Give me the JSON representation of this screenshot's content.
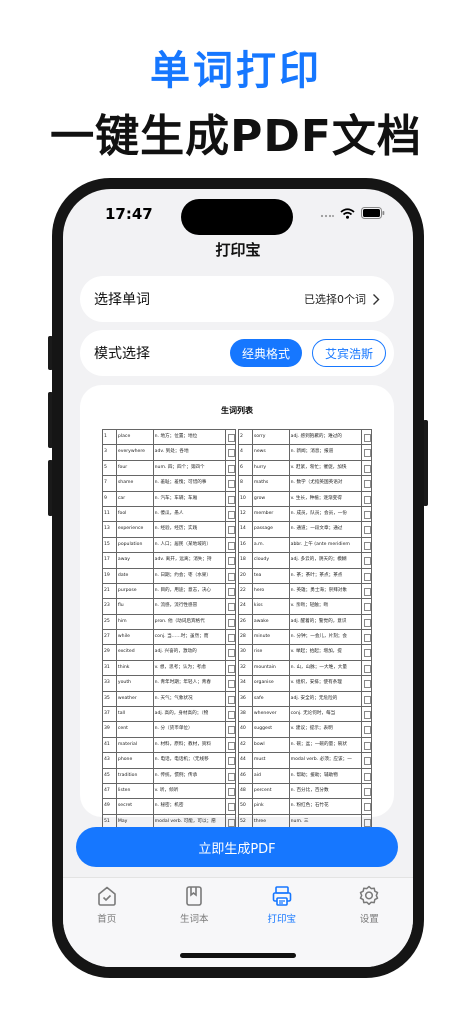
{
  "hero": {
    "title": "单词打印",
    "subtitle": "一键生成PDF文档"
  },
  "status_bar": {
    "time": "17:47"
  },
  "nav": {
    "title": "打印宝"
  },
  "select_row": {
    "label": "选择单词",
    "value": "已选择0个词"
  },
  "mode_row": {
    "label": "模式选择",
    "options": [
      "经典格式",
      "艾宾浩斯"
    ],
    "selected": "经典格式"
  },
  "preview": {
    "title": "生词列表",
    "left_rows": [
      [
        "1",
        "place",
        "n. 地方；位置；地位"
      ],
      [
        "3",
        "everywhere",
        "adv. 到处；各地"
      ],
      [
        "5",
        "four",
        "num. 四；四个；第四个"
      ],
      [
        "7",
        "shame",
        "n. 羞耻；羞愧；可惜的事"
      ],
      [
        "9",
        "car",
        "n. 汽车；车辆；车厢"
      ],
      [
        "11",
        "fool",
        "n. 傻瓜，愚人"
      ],
      [
        "13",
        "experience",
        "n. 经验，经历；实践"
      ],
      [
        "15",
        "population",
        "n. 人口；居民（某地域的）"
      ],
      [
        "17",
        "away",
        "adv. 离开，远离；消失；持"
      ],
      [
        "19",
        "date",
        "n. 日期；约会；枣（水果）"
      ],
      [
        "21",
        "purpose",
        "n. 目的，用途；意志，决心"
      ],
      [
        "23",
        "flu",
        "n. 流感，流行性感冒"
      ],
      [
        "25",
        "him",
        "pron. 他（动词后宾格代"
      ],
      [
        "27",
        "while",
        "conj. 当……时；虽然；而"
      ],
      [
        "29",
        "excited",
        "adj. 兴奋的，激动的"
      ],
      [
        "31",
        "think",
        "v. 想，思考；认为；考虑"
      ],
      [
        "33",
        "youth",
        "n. 青年时期；年轻人；青春"
      ],
      [
        "35",
        "weather",
        "n. 天气；气象状况"
      ],
      [
        "37",
        "tall",
        "adj. 高的，身材高的；（物"
      ],
      [
        "39",
        "cent",
        "n. 分（货币单位）"
      ],
      [
        "41",
        "material",
        "n. 材料，原料；教材，资料"
      ],
      [
        "43",
        "phone",
        "n. 电话，电话机；（无线移"
      ],
      [
        "45",
        "tradition",
        "n. 传统，惯例；传承"
      ],
      [
        "47",
        "listen",
        "v. 听，倾听"
      ],
      [
        "49",
        "secret",
        "n. 秘密；机密"
      ],
      [
        "51",
        "May",
        "modal verb. 可能，可以；愿"
      ]
    ],
    "right_rows": [
      [
        "2",
        "sorry",
        "adj. 感到抱歉的；难过的"
      ],
      [
        "4",
        "news",
        "n. 新闻；消息；报道"
      ],
      [
        "6",
        "hurry",
        "v. 赶紧，匆忙；催促，加快"
      ],
      [
        "8",
        "maths",
        "n. 数学（尤指英国英语对"
      ],
      [
        "10",
        "grow",
        "v. 生长，种植；逐渐变得"
      ],
      [
        "12",
        "member",
        "n. 成员，队员；会员，一份"
      ],
      [
        "14",
        "passage",
        "n. 通道；一段文章；通过"
      ],
      [
        "16",
        "a.m.",
        "abbr. 上午 (ante meridiem"
      ],
      [
        "18",
        "cloudy",
        "adj. 多云的，阴天的；模糊"
      ],
      [
        "20",
        "tea",
        "n. 茶；茶叶；茶点；茶点"
      ],
      [
        "22",
        "hero",
        "n. 英雄；勇士海；崇拜对象"
      ],
      [
        "24",
        "kiss",
        "v. 亲吻；轻触；吻"
      ],
      [
        "26",
        "awake",
        "adj. 醒着的；警觉的，意识"
      ],
      [
        "28",
        "minute",
        "n. 分钟；一会儿，片刻；会"
      ],
      [
        "30",
        "rise",
        "v. 举起；抬起；增加，提"
      ],
      [
        "32",
        "mountain",
        "n. 山，山脉；一大堆，大量"
      ],
      [
        "34",
        "organise",
        "v. 组织，安排；使有条理"
      ],
      [
        "36",
        "safe",
        "adj. 安全的；无危险的"
      ],
      [
        "38",
        "whenever",
        "conj. 无论何时，每当"
      ],
      [
        "40",
        "suggest",
        "v. 建议；提示；表明"
      ],
      [
        "42",
        "bowl",
        "n. 碗；盆；一碗的量；碗状"
      ],
      [
        "44",
        "must",
        "modal verb. 必须；应该；一"
      ],
      [
        "46",
        "aid",
        "n. 帮助；援助；辅助物"
      ],
      [
        "48",
        "percent",
        "n. 百分比，百分数"
      ],
      [
        "50",
        "pink",
        "n. 粉红色；石竹花"
      ],
      [
        "52",
        "three",
        "num. 三"
      ]
    ]
  },
  "primary_button": {
    "label": "立即生成PDF"
  },
  "tabs": [
    {
      "label": "首页",
      "icon": "home-check-icon"
    },
    {
      "label": "生词本",
      "icon": "bookmark-book-icon"
    },
    {
      "label": "打印宝",
      "icon": "printer-icon"
    },
    {
      "label": "设置",
      "icon": "gear-icon"
    }
  ],
  "active_tab": "打印宝",
  "colors": {
    "accent": "#1677ff",
    "background": "#f2f2f4",
    "phone_frame": "#151515"
  }
}
